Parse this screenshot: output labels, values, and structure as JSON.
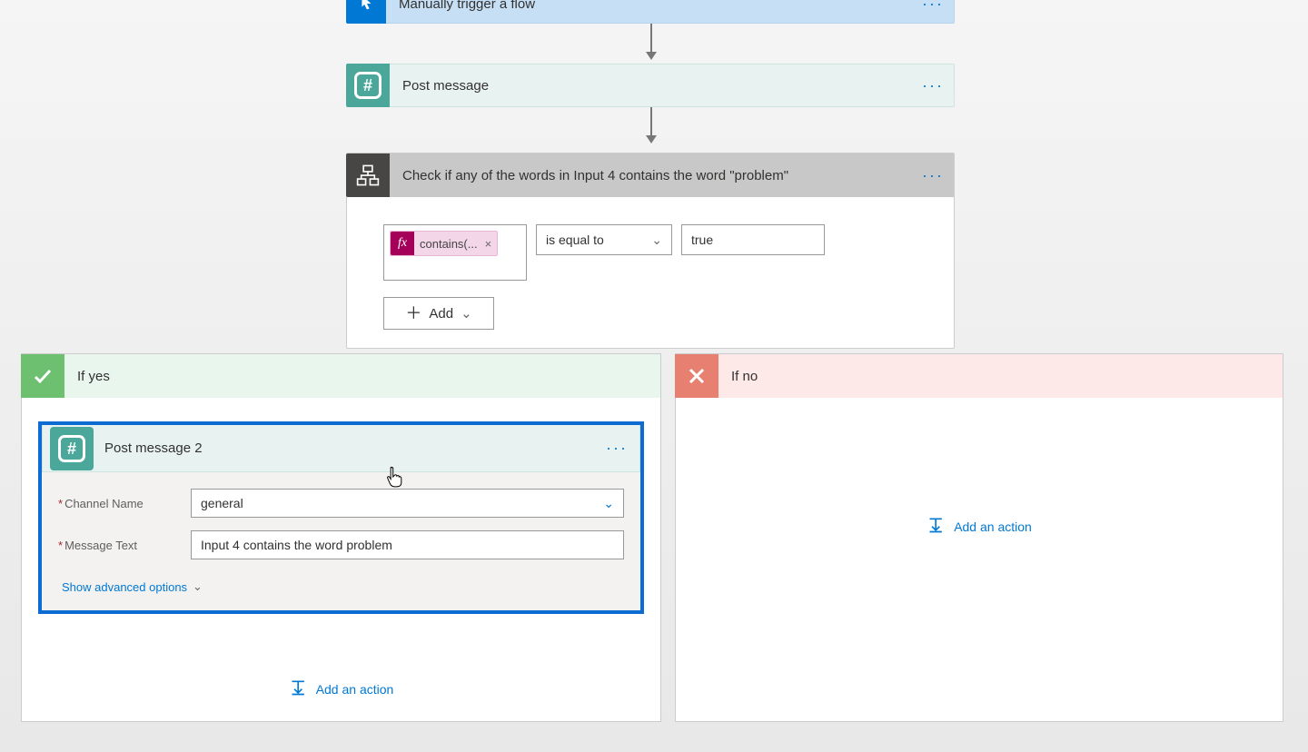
{
  "trigger": {
    "title": "Manually trigger a flow"
  },
  "postMessage": {
    "title": "Post message"
  },
  "condition": {
    "title": "Check if any of the words in Input 4 contains the word \"problem\"",
    "chip": "contains(...",
    "operator": "is equal to",
    "value": "true",
    "addLabel": "Add"
  },
  "yesBranch": {
    "title": "If yes",
    "card": {
      "title": "Post message 2",
      "channelLabel": "Channel Name",
      "channelValue": "general",
      "textLabel": "Message Text",
      "textValue": "Input 4 contains the word problem",
      "advanced": "Show advanced options"
    },
    "addAction": "Add an action"
  },
  "noBranch": {
    "title": "If no",
    "addAction": "Add an action"
  }
}
